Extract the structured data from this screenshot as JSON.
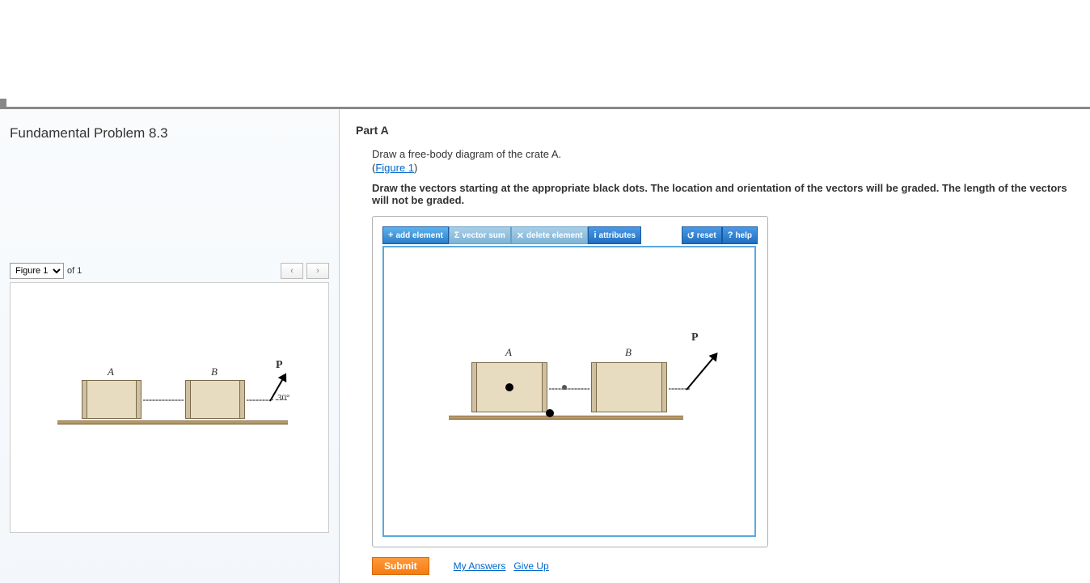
{
  "problem": {
    "title": "Fundamental Problem 8.3"
  },
  "figure_selector": {
    "selected": "Figure 1",
    "of_label": "of 1"
  },
  "part": {
    "title": "Part A",
    "instruction": "Draw a free-body diagram of the crate A.",
    "figure_link": "Figure 1",
    "bold_instruction": "Draw the vectors starting at the appropriate black dots. The location and orientation of the vectors will be graded. The length of the vectors will not be graded."
  },
  "toolbar": {
    "add": "add element",
    "sum": "vector sum",
    "del": "delete element",
    "attr": "attributes",
    "reset": "reset",
    "help": "help"
  },
  "diagram": {
    "crateA": "A",
    "crateB": "B",
    "force": "P",
    "angle": "30°"
  },
  "actions": {
    "submit": "Submit",
    "my_answers": "My Answers",
    "give_up": "Give Up"
  }
}
